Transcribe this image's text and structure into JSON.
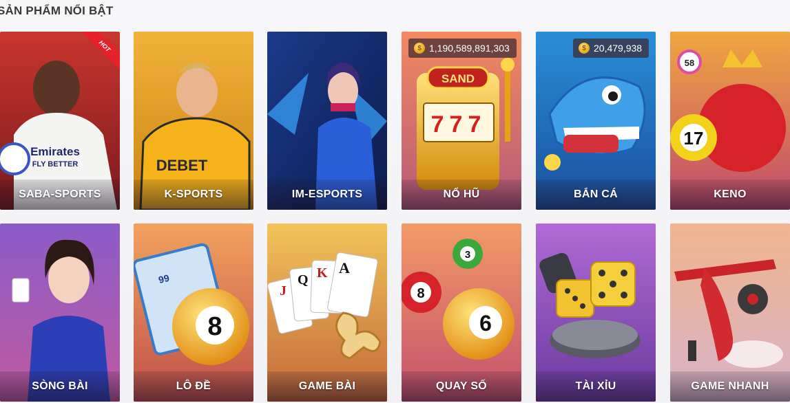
{
  "section": {
    "title": "SẢN PHẨM NỔI BẬT"
  },
  "badges": {
    "hot": "HOT"
  },
  "icons": {
    "coin": "coin-icon"
  },
  "cards": [
    {
      "name": "saba-sports",
      "label": "SABA-SPORTS",
      "jackpot": null
    },
    {
      "name": "k-sports",
      "label": "K-SPORTS",
      "jackpot": null
    },
    {
      "name": "im-esports",
      "label": "IM-ESPORTS",
      "jackpot": null
    },
    {
      "name": "no-hu",
      "label": "NỔ HŨ",
      "jackpot": "1,190,589,891,303"
    },
    {
      "name": "ban-ca",
      "label": "BẮN CÁ",
      "jackpot": "20,479,938"
    },
    {
      "name": "keno",
      "label": "KENO",
      "jackpot": null
    },
    {
      "name": "song-bai",
      "label": "SÒNG BÀI",
      "jackpot": null
    },
    {
      "name": "lo-de",
      "label": "LÔ ĐỀ",
      "jackpot": null
    },
    {
      "name": "game-bai",
      "label": "GAME BÀI",
      "jackpot": null
    },
    {
      "name": "quay-so",
      "label": "QUAY SỐ",
      "jackpot": null
    },
    {
      "name": "tai-xiu",
      "label": "TÀI XỈU",
      "jackpot": null
    },
    {
      "name": "game-nhanh",
      "label": "GAME NHANH",
      "jackpot": null
    }
  ],
  "art_text": {
    "jersey": "Emirates",
    "jersey2": "FLY BETTER",
    "sponsor": "DEBET",
    "slot_sign": "SAND",
    "slot_reels": "777",
    "keno_ball1": "58",
    "keno_ball2": "17",
    "lode_ball": "8",
    "quay_ball1": "8",
    "quay_ball2": "3",
    "quay_ball3": "6",
    "lode_ticket": "99",
    "cards_j": "J",
    "cards_q": "Q",
    "cards_k": "K",
    "cards_a": "A"
  }
}
